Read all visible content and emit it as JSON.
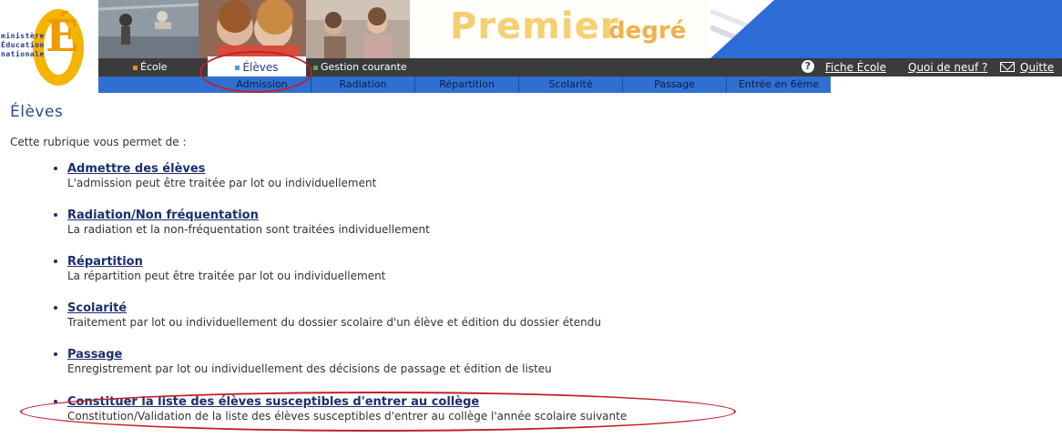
{
  "logo": {
    "lines": [
      "ministère",
      "Éducation",
      "nationale"
    ],
    "letter": "É"
  },
  "banner": {
    "title_main": "Premier",
    "title_sub": "degré"
  },
  "topmenu": [
    {
      "label": "École",
      "bullet_color": "#f08a1c"
    },
    {
      "label": "Élèves",
      "bullet_color": "#4aa0d0",
      "active": true
    },
    {
      "label": "Gestion courante",
      "bullet_color": "#58b045"
    }
  ],
  "top_right": {
    "fiche": "Fiche École",
    "quoi": "Quoi de neuf ?",
    "quitter": "Quitte"
  },
  "submenu": [
    "Admission",
    "Radiation",
    "Répartition",
    "Scolarité",
    "Passage",
    "Entrée en 6ème"
  ],
  "content": {
    "title": "Élèves",
    "intro": "Cette rubrique vous permet de :",
    "items": [
      {
        "link": "Admettre des élèves",
        "desc": "L'admission peut être traitée par lot ou individuellement"
      },
      {
        "link": "Radiation/Non fréquentation ",
        "desc": "La radiation et la non-fréquentation sont traitées individuellement"
      },
      {
        "link": "Répartition",
        "desc": "La répartition peut être traitée par lot ou individuellement"
      },
      {
        "link": "Scolarité",
        "desc": "Traitement par lot ou individuellement du dossier scolaire d'un élève et édition du dossier étendu"
      },
      {
        "link": "Passage",
        "desc": "Enregistrement par lot ou individuellement des décisions de passage et édition de listeu"
      },
      {
        "link": "Constituer la liste des élèves susceptibles d'entrer au collège",
        "desc": "Constitution/Validation de la liste des élèves susceptibles d'entrer au collège l'année scolaire suivante"
      }
    ]
  },
  "colors": {
    "accent_blue": "#2d6bd6",
    "menu_dark": "#3b3b3b",
    "highlight_red": "#c31f2a",
    "link": "#1b2e6e"
  }
}
